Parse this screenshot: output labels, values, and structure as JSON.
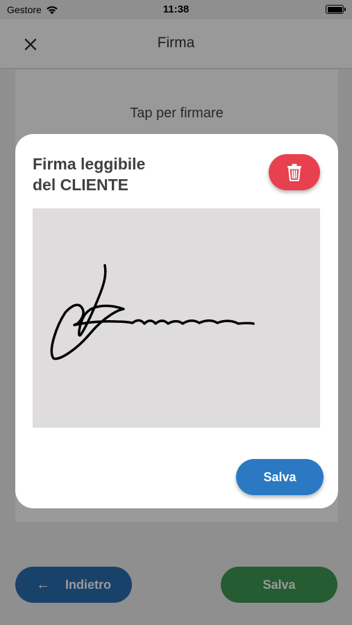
{
  "status_bar": {
    "carrier": "Gestore",
    "time": "11:38"
  },
  "header": {
    "title": "Firma",
    "close_icon": "close-icon"
  },
  "background": {
    "hint": "Tap per firmare"
  },
  "bottom_bar": {
    "back_label": "Indietro",
    "back_icon": "arrow-left-icon",
    "save_label": "Salva",
    "back_color": "#2b6fb3",
    "save_color": "#3f9a54"
  },
  "modal": {
    "title_line1": "Firma leggibile",
    "title_line2": "del CLIENTE",
    "delete_icon": "trash-icon",
    "delete_color": "#e8404f",
    "save_label": "Salva",
    "save_color": "#2a79c2",
    "pad_color": "#dfdcdd"
  }
}
